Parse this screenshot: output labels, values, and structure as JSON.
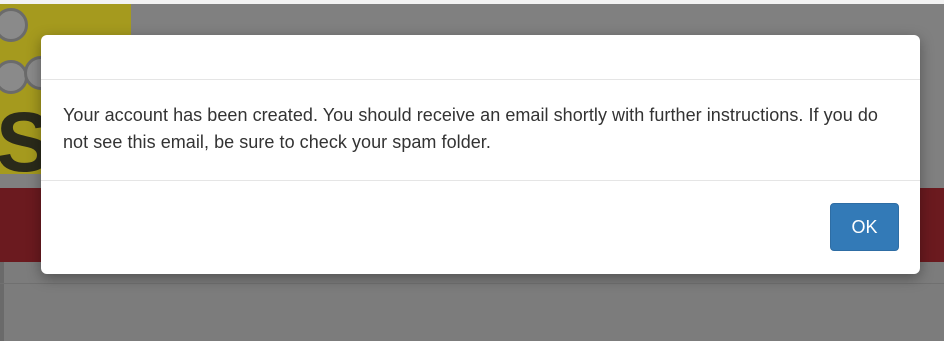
{
  "modal": {
    "message": "Your account has been created. You should receive an email shortly with further instructions. If you do not see this email, be sure to check your spam folder.",
    "ok_label": "OK"
  },
  "background": {
    "logo_letter": "S"
  },
  "colors": {
    "primary_button": "#337ab7",
    "overlay_gray": "#808080",
    "background_red": "#6b1a1f",
    "background_yellow": "#a59a1e"
  }
}
